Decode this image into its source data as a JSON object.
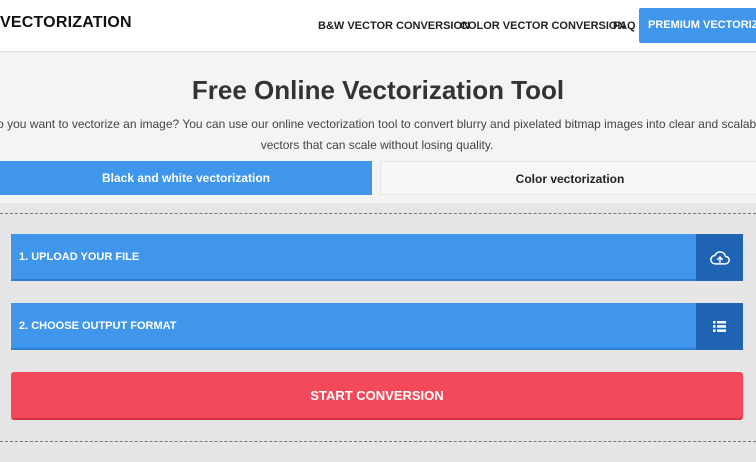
{
  "header": {
    "logo": "VECTORIZATION",
    "nav": {
      "bw": "B&W VECTOR CONVERSION",
      "color": "COLOR VECTOR CONVERSION",
      "faq": "FAQ",
      "premium": "PREMIUM VECTORIZATION"
    }
  },
  "hero": {
    "title": "Free Online Vectorization Tool",
    "description": "Do you want to vectorize an image? You can use our online vectorization tool to convert blurry and pixelated bitmap images into clear and scalable vectors that can scale without losing quality."
  },
  "tabs": {
    "bw": "Black and white vectorization",
    "color": "Color vectorization"
  },
  "steps": {
    "upload": {
      "label": "1. UPLOAD YOUR FILE",
      "icon": "cloud-upload-icon"
    },
    "format": {
      "label": "2. CHOOSE OUTPUT FORMAT",
      "icon": "list-icon"
    }
  },
  "start_button": "START CONVERSION",
  "colors": {
    "primary_blue": "#3f96ea",
    "dark_blue": "#1f63b3",
    "start_red": "#f4495a"
  }
}
